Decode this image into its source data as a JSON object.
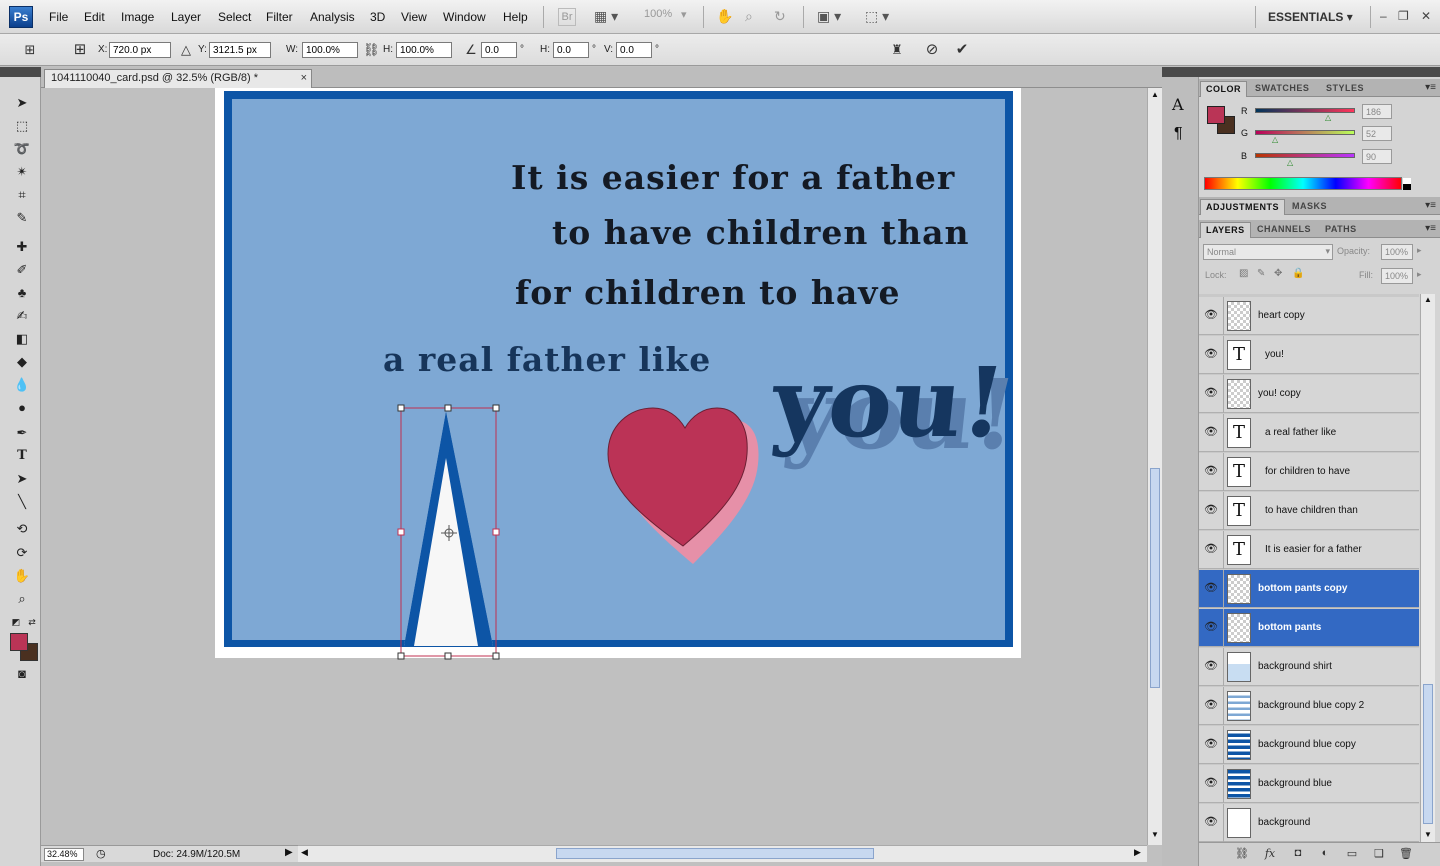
{
  "app": {
    "logo": "Ps",
    "menu": [
      "File",
      "Edit",
      "Image",
      "Layer",
      "Select",
      "Filter",
      "Analysis",
      "3D",
      "View",
      "Window",
      "Help"
    ],
    "bridge_label": "Br",
    "zoom_dropdown": "100%",
    "workspace": "ESSENTIALS"
  },
  "options": {
    "x_label": "X:",
    "x_value": "720.0 px",
    "y_label": "Y:",
    "y_value": "3121.5 px",
    "w_label": "W:",
    "w_value": "100.0%",
    "h_label": "H:",
    "h_value": "100.0%",
    "angle_value": "0.0",
    "angle_unit": "°",
    "hskew_label": "H:",
    "hskew_value": "0.0",
    "hskew_unit": "°",
    "vskew_label": "V:",
    "vskew_value": "0.0",
    "vskew_unit": "°"
  },
  "document": {
    "tab_title": "1041110040_card.psd @ 32.5% (RGB/8) *",
    "close_glyph": "×",
    "quote_lines": [
      "It is easier for a father",
      "to have children than",
      "for children to have",
      "a real father like"
    ],
    "you_text": "you!"
  },
  "status": {
    "zoom": "32.48%",
    "doc_size": "Doc: 24.9M/120.5M"
  },
  "colors": {
    "foreground": "#ba3456",
    "background": "#4a3020",
    "card_border": "#0d55a6",
    "card_fill": "#7ea8d4",
    "heart": "#bb3356",
    "heart_shadow": "#e690a8",
    "selection": "#3369c3"
  },
  "color_panel": {
    "tabs": [
      "COLOR",
      "SWATCHES",
      "STYLES"
    ],
    "r_label": "R",
    "r_value": "186",
    "g_label": "G",
    "g_value": "52",
    "b_label": "B",
    "b_value": "90"
  },
  "adjust_panel": {
    "tabs": [
      "ADJUSTMENTS",
      "MASKS"
    ]
  },
  "layers_panel": {
    "tabs": [
      "LAYERS",
      "CHANNELS",
      "PATHS"
    ],
    "blend_mode": "Normal",
    "opacity_label": "Opacity:",
    "opacity_value": "100%",
    "lock_label": "Lock:",
    "fill_label": "Fill:",
    "fill_value": "100%",
    "layers": [
      {
        "name": "heart copy",
        "kind": "raster",
        "selected": false
      },
      {
        "name": "you!",
        "kind": "text",
        "selected": false
      },
      {
        "name": "you! copy",
        "kind": "raster",
        "selected": false
      },
      {
        "name": "a real father like",
        "kind": "text",
        "selected": false
      },
      {
        "name": "for children to have",
        "kind": "text",
        "selected": false
      },
      {
        "name": "to have children than",
        "kind": "text",
        "selected": false
      },
      {
        "name": "It is easier for a father",
        "kind": "text",
        "selected": false
      },
      {
        "name": "bottom pants copy",
        "kind": "raster",
        "selected": true
      },
      {
        "name": "bottom pants",
        "kind": "raster",
        "selected": true
      },
      {
        "name": "background shirt",
        "kind": "raster",
        "selected": false
      },
      {
        "name": "background blue copy 2",
        "kind": "raster",
        "selected": false
      },
      {
        "name": "background blue copy",
        "kind": "raster",
        "selected": false
      },
      {
        "name": "background blue",
        "kind": "raster",
        "selected": false
      },
      {
        "name": "background",
        "kind": "raster",
        "selected": false
      }
    ]
  }
}
